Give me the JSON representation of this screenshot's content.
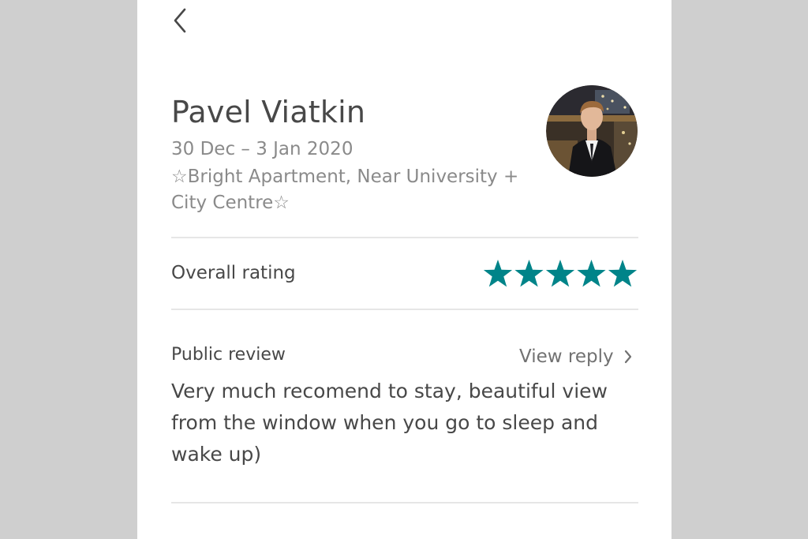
{
  "nav": {
    "back_icon": "chevron-left-icon"
  },
  "host": {
    "name": "Pavel Viatkin",
    "dates": "30 Dec – 3 Jan 2020",
    "listing": "☆Bright Apartment, Near University + City Centre☆",
    "avatar_icon": "user-photo"
  },
  "rating": {
    "label": "Overall rating",
    "value": 5,
    "max": 5,
    "star_color": "#008489"
  },
  "review": {
    "label": "Public review",
    "view_reply": "View reply",
    "text": "Very much recomend to stay, beautiful view from the window when you go to sleep and wake up)"
  }
}
